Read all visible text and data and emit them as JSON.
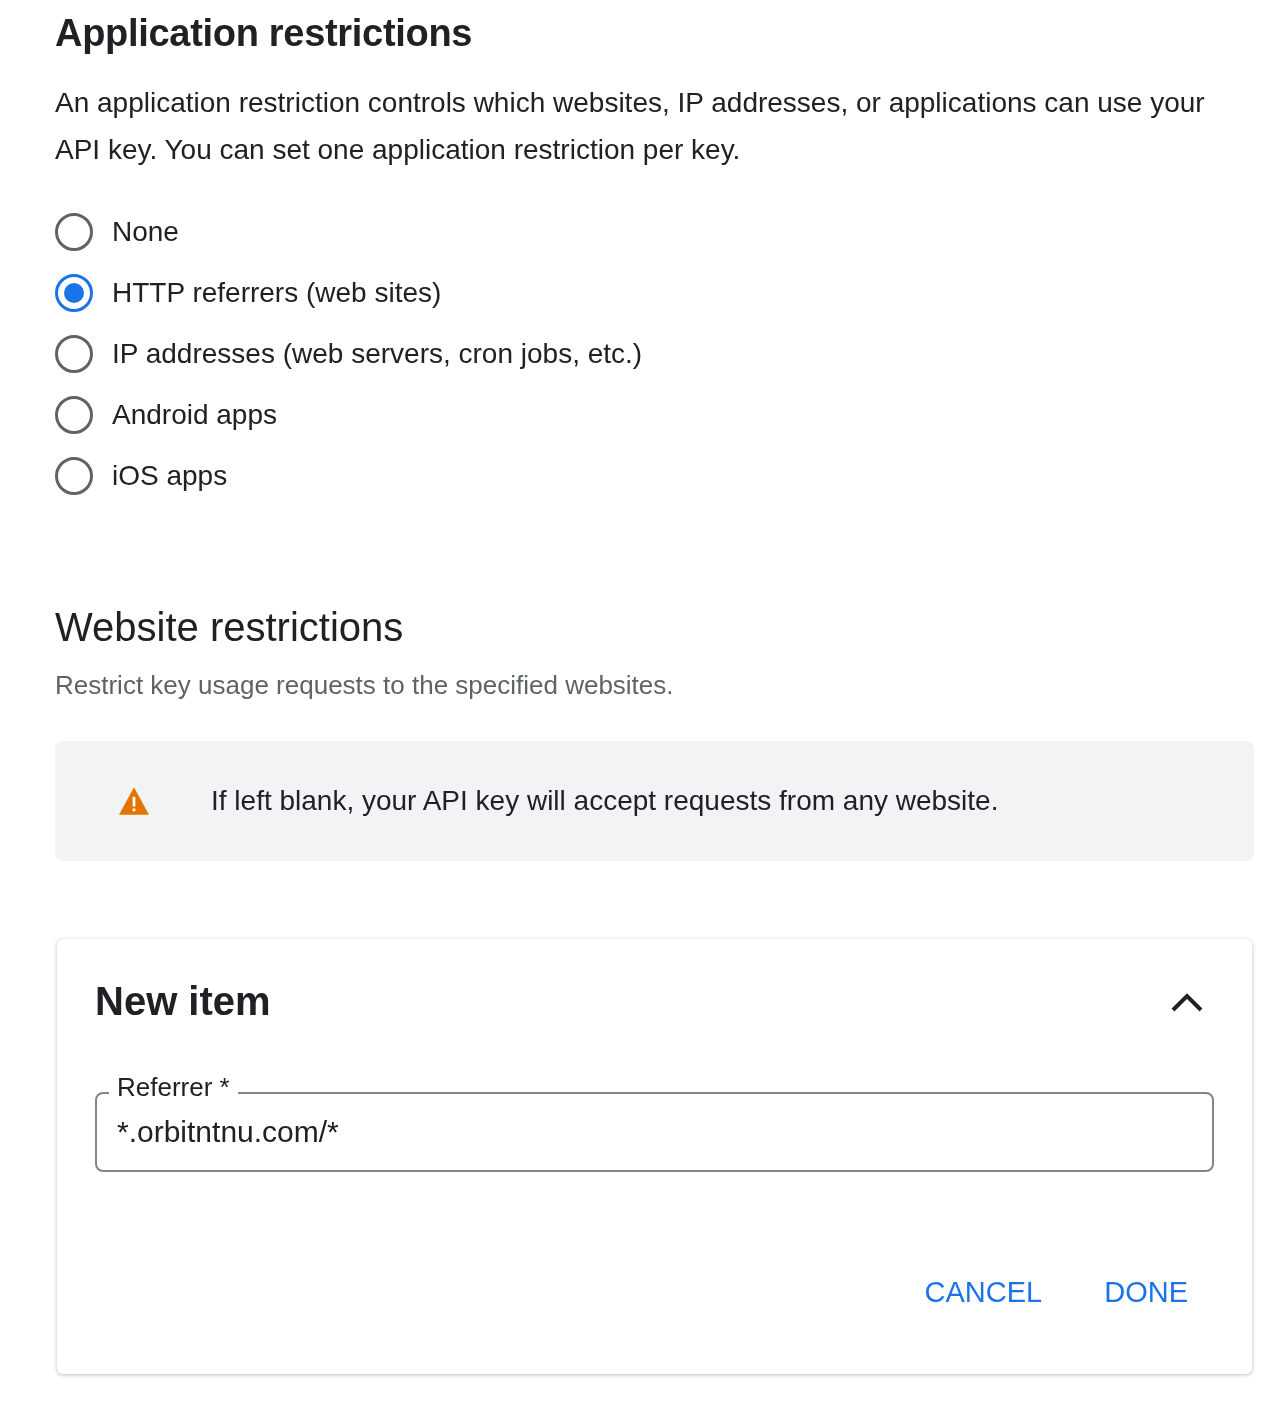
{
  "application_restrictions": {
    "title": "Application restrictions",
    "description": "An application restriction controls which websites, IP addresses, or applications can use your API key. You can set one application restriction per key.",
    "options": [
      {
        "label": "None",
        "selected": false
      },
      {
        "label": "HTTP referrers (web sites)",
        "selected": true
      },
      {
        "label": "IP addresses (web servers, cron jobs, etc.)",
        "selected": false
      },
      {
        "label": "Android apps",
        "selected": false
      },
      {
        "label": "iOS apps",
        "selected": false
      }
    ]
  },
  "website_restrictions": {
    "title": "Website restrictions",
    "description": "Restrict key usage requests to the specified websites.",
    "warning": "If left blank, your API key will accept requests from any website."
  },
  "new_item": {
    "title": "New item",
    "expanded": true,
    "field": {
      "label": "Referrer *",
      "value": "*.orbitntnu.com/*"
    },
    "buttons": [
      "CANCEL",
      "DONE"
    ]
  }
}
